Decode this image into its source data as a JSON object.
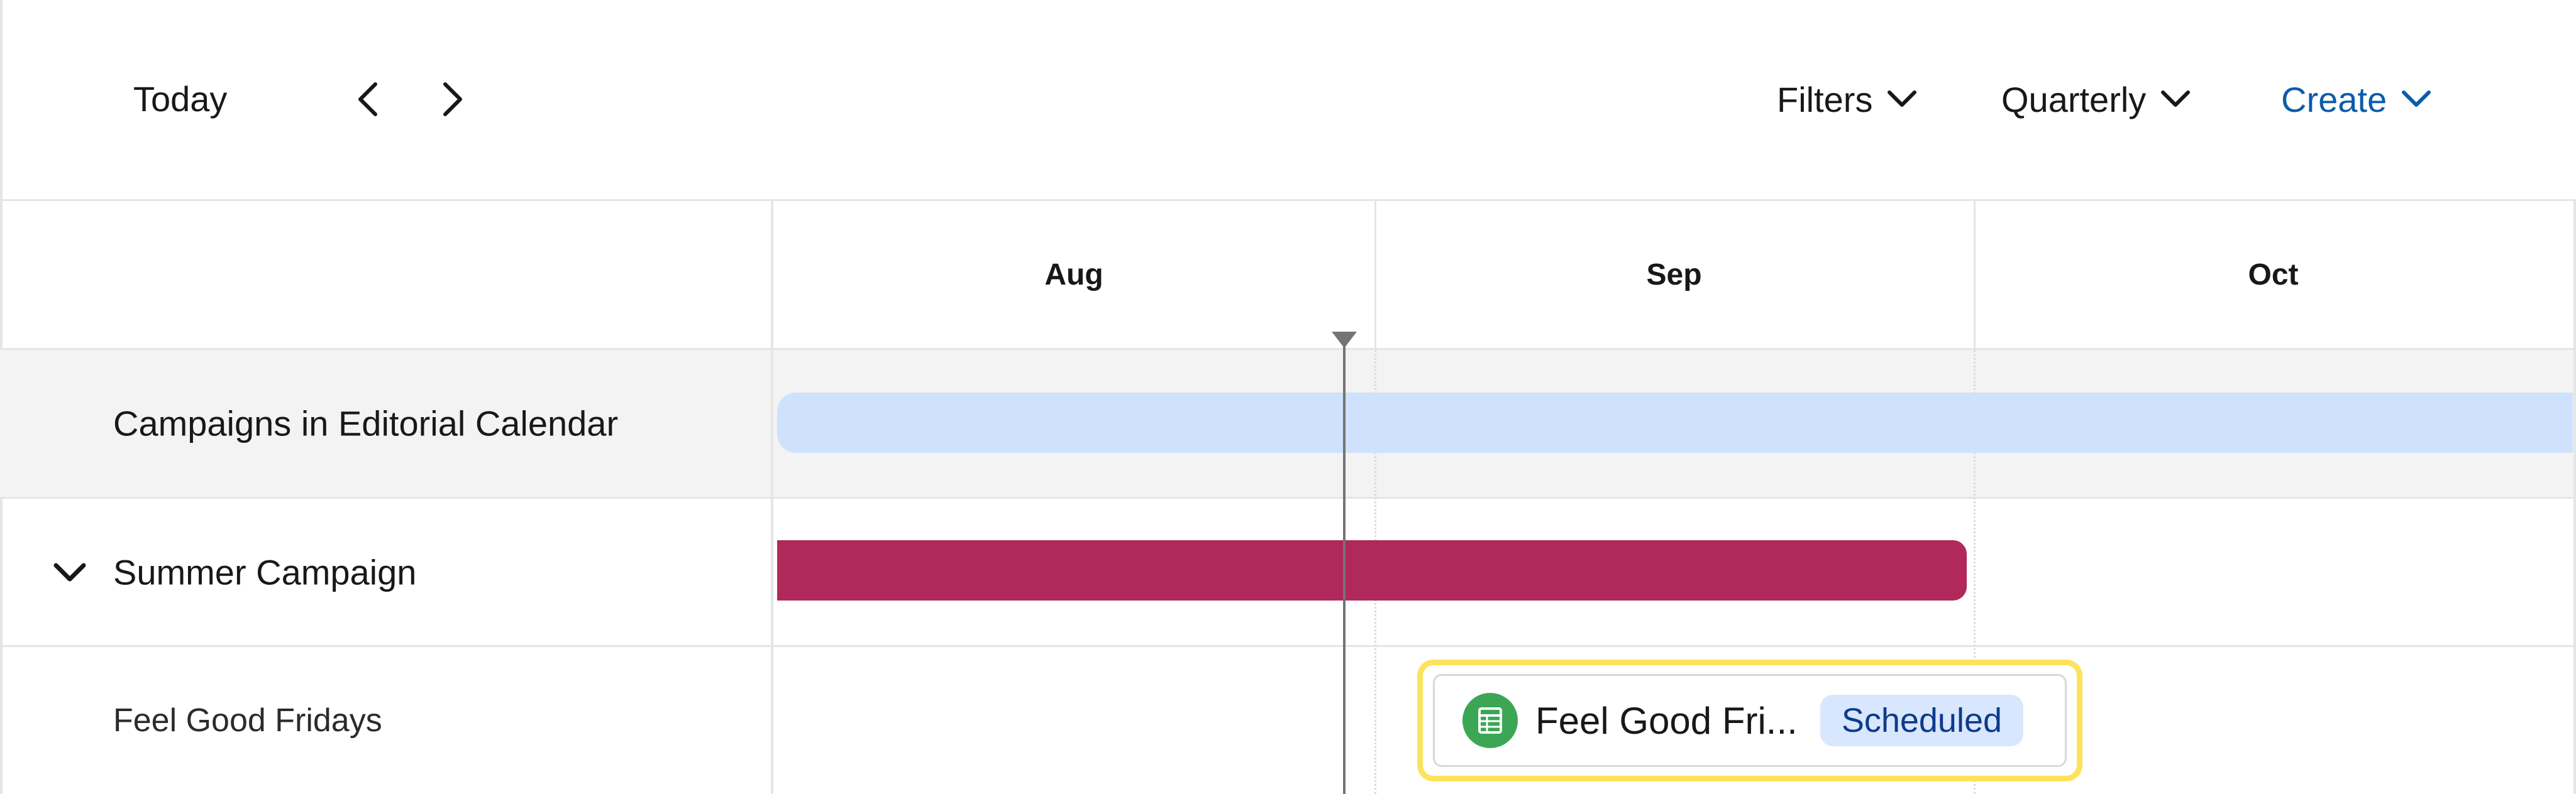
{
  "toolbar": {
    "today_label": "Today",
    "filters_label": "Filters",
    "view_label": "Quarterly",
    "create_label": "Create"
  },
  "timeline": {
    "months": [
      "Aug",
      "Sep",
      "Oct"
    ]
  },
  "rows": [
    {
      "label": "Campaigns in Editorial Calendar"
    },
    {
      "label": "Summer Campaign",
      "expanded": true
    },
    {
      "label": "Feel Good Fridays"
    }
  ],
  "item": {
    "title": "Feel Good Fri...",
    "status": "Scheduled",
    "icon": "spreadsheet-icon"
  },
  "colors": {
    "accent": "#0b5cab",
    "campaigns_bar": "#cfe2fd",
    "summer_bar": "#b0295a",
    "item_icon": "#3ba755",
    "highlight": "#fde35b",
    "status_badge_bg": "#d8e6fe"
  }
}
